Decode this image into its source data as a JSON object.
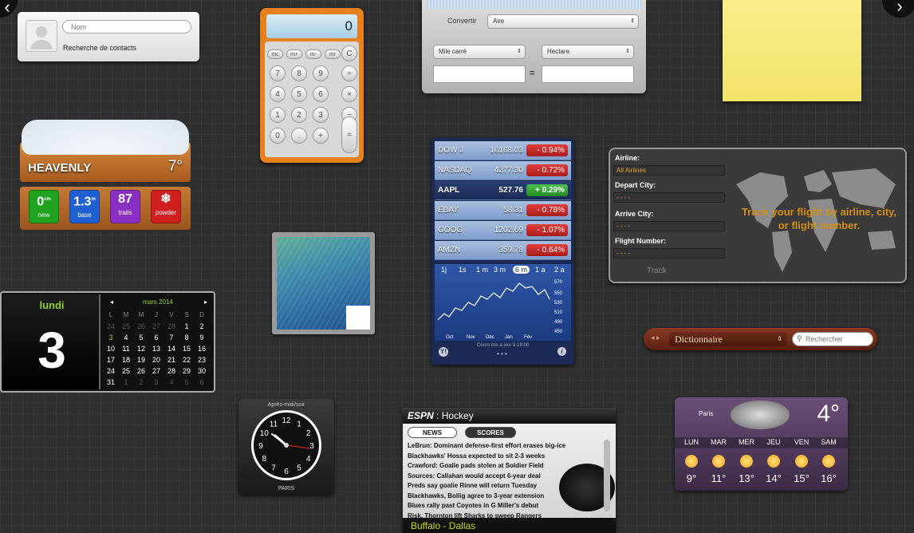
{
  "contacts": {
    "name_placeholder": "Nom",
    "label": "Recherche de contacts"
  },
  "calculator": {
    "display": "0",
    "memory_keys": [
      "mc",
      "m+",
      "m-",
      "mr"
    ],
    "op_keys": [
      "C",
      "=",
      "÷",
      "×",
      "−",
      "+"
    ],
    "digits": [
      "7",
      "8",
      "9",
      "4",
      "5",
      "6",
      "1",
      "2",
      "3",
      "0",
      "."
    ]
  },
  "converter": {
    "label": "Convertir",
    "category": "Aire",
    "from_unit": "Mile carré",
    "to_unit": "Hectare",
    "equals": "="
  },
  "ski": {
    "resort": "HEAVENLY",
    "temperature": "7°",
    "stats": [
      {
        "value": "0",
        "unit": "cm",
        "label": "new",
        "color": "#1fa31f"
      },
      {
        "value": "1.3",
        "unit": "m",
        "label": "base",
        "color": "#1f5fd1"
      },
      {
        "value": "87",
        "unit": "",
        "label": "trails",
        "color": "#8a2fc4"
      },
      {
        "value": "❄",
        "unit": "",
        "label": "powder",
        "color": "#d11f1f"
      }
    ]
  },
  "stocks": {
    "rows": [
      {
        "symbol": "DOW J",
        "price": "16168.03",
        "change": "- 0.94%",
        "dir": "neg"
      },
      {
        "symbol": "NASDAQ",
        "price": "4277.30",
        "change": "- 0.72%",
        "dir": "neg"
      },
      {
        "symbol": "AAPL",
        "price": "527.76",
        "change": "+ 0.29%",
        "dir": "pos"
      },
      {
        "symbol": "EBAY",
        "price": "58.31",
        "change": "- 0.78%",
        "dir": "neg"
      },
      {
        "symbol": "GOOG",
        "price": "1202.69",
        "change": "- 1.07%",
        "dir": "neg"
      },
      {
        "symbol": "AMZN",
        "price": "359.78",
        "change": "- 0.64%",
        "dir": "neg"
      }
    ],
    "ranges": [
      "1j",
      "1s",
      "1 m",
      "3 m",
      "6 m",
      "1 a",
      "2 a"
    ],
    "selected_range": "6 m",
    "y_ticks": [
      "570",
      "550",
      "530",
      "510",
      "490",
      "450"
    ],
    "x_ticks": [
      "Oct",
      "Nov",
      "Déc",
      "Jan",
      "Fév"
    ],
    "footer": "Cours mis à jour à 19:00"
  },
  "flight": {
    "airline_label": "Airline:",
    "airline_value": "All Airlines",
    "depart_label": "Depart City:",
    "arrive_label": "Arrive City:",
    "number_label": "Flight Number:",
    "placeholder": "- - - -",
    "track_button": "Track",
    "message": "Track your flight by airline, city, or flight number."
  },
  "calendar": {
    "day_name": "lundi",
    "day_number": "3",
    "month": "mars 2014",
    "weekdays": [
      "L",
      "M",
      "M",
      "J",
      "V",
      "S",
      "D"
    ],
    "weeks": [
      [
        "24",
        "25",
        "26",
        "27",
        "28",
        "1",
        "2"
      ],
      [
        "3",
        "4",
        "5",
        "6",
        "7",
        "8",
        "9"
      ],
      [
        "10",
        "11",
        "12",
        "13",
        "14",
        "15",
        "16"
      ],
      [
        "17",
        "18",
        "19",
        "20",
        "21",
        "22",
        "23"
      ],
      [
        "24",
        "25",
        "26",
        "27",
        "28",
        "29",
        "30"
      ],
      [
        "31",
        "1",
        "2",
        "3",
        "4",
        "5",
        "6"
      ]
    ]
  },
  "dictionary": {
    "source": "Dictionnaire",
    "search_placeholder": "Rechercher"
  },
  "clock": {
    "period": "Après-midi/soir",
    "city": "PARIS",
    "numerals": [
      "12",
      "1",
      "2",
      "3",
      "4",
      "5",
      "6",
      "7",
      "8",
      "9",
      "10",
      "11"
    ]
  },
  "espn": {
    "brand": "ESPN",
    "sport": "Hockey",
    "tabs": [
      "NEWS",
      "SCORES"
    ],
    "headlines": [
      "LeBrun: Dominant defense-first effort erases big-ice",
      "Blackhawks' Hossa expected to sit 2-3 weeks",
      "Crawford: Goalie pads stolen at Soldier Field",
      "Sources: Callahan would accept 6-year deal",
      "Preds say goalie Rinne will return Tuesday",
      "Blackhawks, Bollig agree to 3-year extension",
      "Blues rally past Coyotes in G Miller's debut",
      "Risk, Thornton lift Sharks to sweep Rangers"
    ],
    "ticker": "Buffalo - Dallas"
  },
  "weather": {
    "city": "Paris",
    "current_temp": "4°",
    "days": [
      {
        "day": "LUN",
        "temp": "9°"
      },
      {
        "day": "MAR",
        "temp": "11°"
      },
      {
        "day": "MER",
        "temp": "13°"
      },
      {
        "day": "JEU",
        "temp": "14°"
      },
      {
        "day": "VEN",
        "temp": "15°"
      },
      {
        "day": "SAM",
        "temp": "16°"
      }
    ]
  },
  "nav": {
    "prev": "‹",
    "next": "›"
  }
}
